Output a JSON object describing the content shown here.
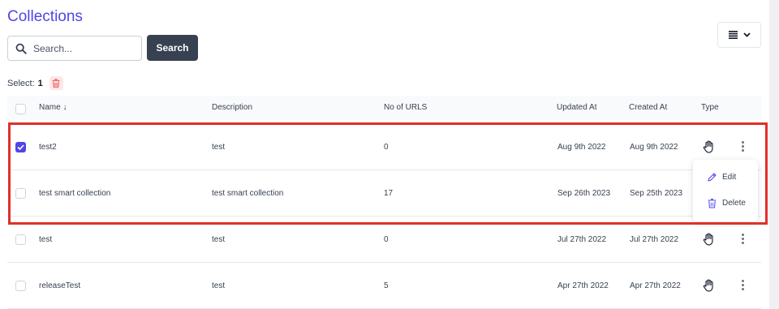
{
  "header": {
    "title": "Collections"
  },
  "search": {
    "placeholder": "Search...",
    "button_label": "Search"
  },
  "selection": {
    "label": "Select:",
    "count": "1"
  },
  "table": {
    "columns": {
      "name": "Name ↓",
      "description": "Description",
      "urls": "No of URLS",
      "updated": "Updated At",
      "created": "Created At",
      "type": "Type"
    },
    "rows": [
      {
        "name": "test2",
        "description": "test",
        "urls": "0",
        "updated": "Aug 9th 2022",
        "created": "Aug 9th 2022",
        "checked": true,
        "type_icon": "hand-icon"
      },
      {
        "name": "test smart collection",
        "description": "test smart collection",
        "urls": "17",
        "updated": "Sep 26th 2023",
        "created": "Sep 25th 2023",
        "checked": false,
        "type_icon": ""
      },
      {
        "name": "test",
        "description": "test",
        "urls": "0",
        "updated": "Jul 27th 2022",
        "created": "Jul 27th 2022",
        "checked": false,
        "type_icon": "hand-icon"
      },
      {
        "name": "releaseTest",
        "description": "test",
        "urls": "5",
        "updated": "Apr 27th 2022",
        "created": "Apr 27th 2022",
        "checked": false,
        "type_icon": "hand-icon"
      }
    ]
  },
  "menu": {
    "edit_label": "Edit",
    "delete_label": "Delete"
  },
  "colors": {
    "accent": "#4f46e5",
    "button_dark": "#374151",
    "danger": "#ef4444",
    "highlight": "#e0302a"
  }
}
